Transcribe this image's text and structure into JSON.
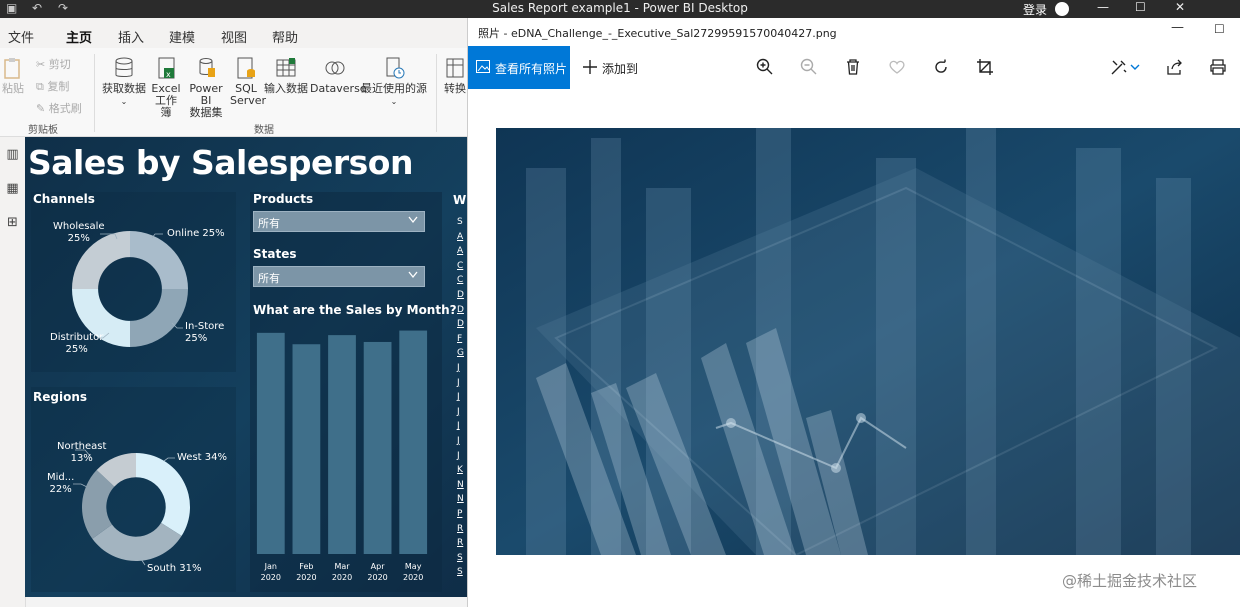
{
  "pbi_window": {
    "title": "Sales Report example1 - Power BI Desktop",
    "login": "登录"
  },
  "menu": [
    {
      "label": "文件"
    },
    {
      "label": "主页"
    },
    {
      "label": "插入"
    },
    {
      "label": "建模"
    },
    {
      "label": "视图"
    },
    {
      "label": "帮助"
    }
  ],
  "ribbon": {
    "paste": "粘贴",
    "cut": "剪切",
    "copy": "复制",
    "format_painter": "格式刷",
    "clipboard_group": "剪贴板",
    "get_data": "获取数据",
    "excel_line1": "Excel",
    "excel_line2": "工作簿",
    "powerbi_line1": "Power BI",
    "powerbi_line2": "数据集",
    "sql_line1": "SQL",
    "sql_line2": "Server",
    "enter_data": "输入数据",
    "dataverse": "Dataverse",
    "recent_sources": "最近使用的源",
    "data_group": "数据",
    "transform": "转换"
  },
  "report": {
    "title": "Sales by Salesperson",
    "channels": {
      "title": "Channels",
      "labels": [
        {
          "line1": "Wholesale",
          "line2": "25%"
        },
        {
          "line1": "Online 25%",
          "line2": ""
        },
        {
          "line1": "In-Store",
          "line2": "25%"
        },
        {
          "line1": "Distributor",
          "line2": "25%"
        }
      ]
    },
    "regions": {
      "title": "Regions",
      "labels": [
        {
          "line1": "Northeast",
          "line2": "13%"
        },
        {
          "line1": "West 34%",
          "line2": ""
        },
        {
          "line1": "Mid...",
          "line2": "22%"
        },
        {
          "line1": "South 31%",
          "line2": ""
        }
      ]
    },
    "products_slicer": {
      "title": "Products",
      "value": "所有"
    },
    "states_slicer": {
      "title": "States",
      "value": "所有"
    },
    "who_title": "Wh",
    "who_items": [
      "S",
      "A",
      "A",
      "C",
      "C",
      "D",
      "D",
      "D",
      "F",
      "G",
      "J",
      "J",
      "J",
      "J",
      "J",
      "J",
      "J",
      "K",
      "N",
      "N",
      "P",
      "R",
      "R",
      "S",
      "S"
    ]
  },
  "chart_data": {
    "type": "bar",
    "title": "What are the Sales by Month?",
    "categories": [
      "Jan 2020",
      "Feb 2020",
      "Mar 2020",
      "Apr 2020",
      "May 2020"
    ],
    "category_lines": [
      [
        "Jan",
        "2020"
      ],
      [
        "Feb",
        "2020"
      ],
      [
        "Mar",
        "2020"
      ],
      [
        "Apr",
        "2020"
      ],
      [
        "May",
        "2020"
      ]
    ],
    "values": [
      97,
      92,
      96,
      93,
      98
    ],
    "ylim": [
      0,
      100
    ],
    "bar_color": "#3f6f8a",
    "grid": false
  },
  "donut_channels": {
    "slices": [
      {
        "name": "Online",
        "value": 25,
        "color": "#a9bccb"
      },
      {
        "name": "In-Store",
        "value": 25,
        "color": "#8fa6b6"
      },
      {
        "name": "Distributor",
        "value": 25,
        "color": "#d6ecf5"
      },
      {
        "name": "Wholesale",
        "value": 25,
        "color": "#c4cdd4"
      }
    ]
  },
  "donut_regions": {
    "slices": [
      {
        "name": "West",
        "value": 34,
        "color": "#d9f0fa"
      },
      {
        "name": "South",
        "value": 31,
        "color": "#a3b4c0"
      },
      {
        "name": "Mid...",
        "value": 22,
        "color": "#8a9eac"
      },
      {
        "name": "Northeast",
        "value": 13,
        "color": "#c5ccd2"
      }
    ]
  },
  "photos_window": {
    "title": "照片 - eDNA_Challenge_-_Executive_Sal27299591570040427.png",
    "see_all": "查看所有照片",
    "add_to": "添加到",
    "tools": [
      "zoom-in-icon",
      "zoom-out-icon",
      "delete-icon",
      "favorite-icon",
      "rotate-icon",
      "crop-icon",
      "edit-icon",
      "share-icon",
      "print-icon"
    ]
  },
  "watermark": "@稀土掘金技术社区"
}
